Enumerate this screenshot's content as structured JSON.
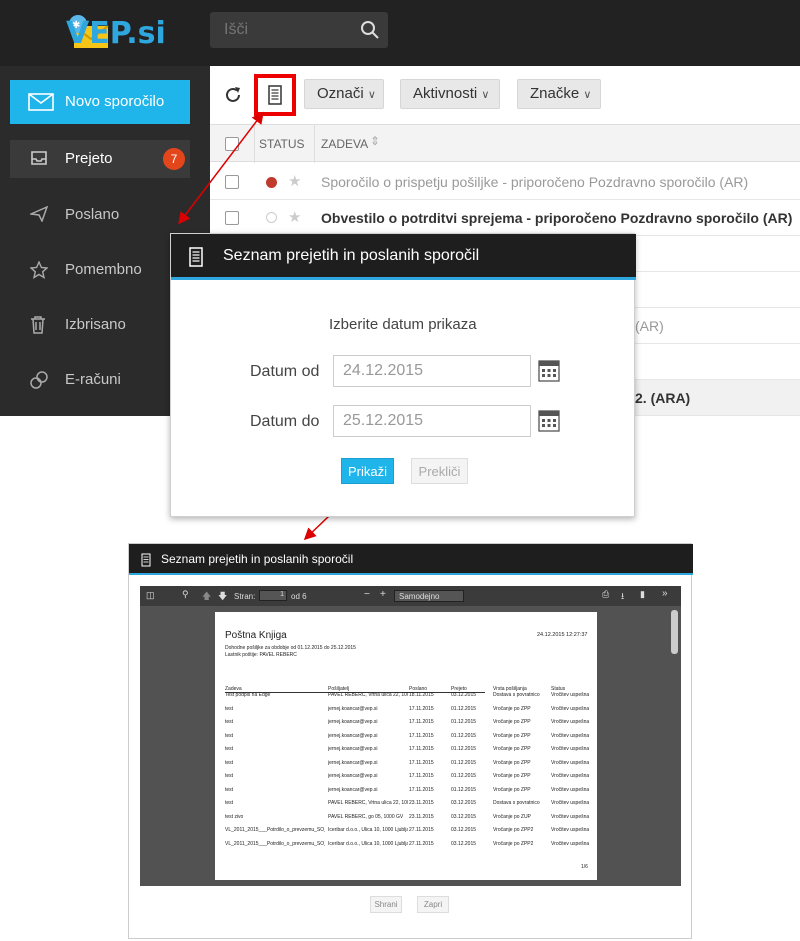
{
  "app": {
    "logo_text": "VEP.si",
    "search_placeholder": "Išči"
  },
  "sidebar": {
    "new_message": "Novo sporočilo",
    "items": [
      {
        "label": "Prejeto",
        "badge": "7"
      },
      {
        "label": "Poslano"
      },
      {
        "label": "Pomembno"
      },
      {
        "label": "Izbrisano"
      },
      {
        "label": "E-računi"
      }
    ]
  },
  "toolbar": {
    "oznaci": "Označi",
    "aktivnosti": "Aktivnosti",
    "znacke": "Značke"
  },
  "table": {
    "headers": {
      "status": "STATUS",
      "subject": "ZADEVA"
    },
    "rows": [
      {
        "subject": "Sporočilo o prispetju pošiljke - priporočeno Pozdravno sporočilo (AR)",
        "bold": false
      },
      {
        "subject": "Obvestilo o potrditvi sprejema - priporočeno Pozdravno sporočilo (AR)",
        "bold": true
      },
      {
        "subject": "(AR)",
        "bold": false
      },
      {
        "subject": "2. (ARA)",
        "bold": true
      }
    ]
  },
  "dialog": {
    "title": "Seznam prejetih in poslanih sporočil",
    "subtitle": "Izberite datum prikaza",
    "from_label": "Datum od",
    "from_value": "24.12.2015",
    "to_label": "Datum do",
    "to_value": "25.12.2015",
    "show_button": "Prikaži",
    "cancel_button": "Prekliči"
  },
  "report": {
    "title": "Seznam prejetih in poslanih sporočil",
    "pdf_toolbar": {
      "page_label": "Stran:",
      "page_value": "1",
      "of_label": "od 6",
      "zoom": "Samodejno"
    },
    "doc_title": "Poštna Knjiga",
    "doc_date": "24.12.2015 12:27:37",
    "doc_line1": "Dohodne pošiljke za obdobje od 01.12.2015 do 25.12.2015",
    "doc_line2": "Lastnik poštije: PAVEL REBERC",
    "columns": [
      "Zadeva",
      "Pošiljatelj",
      "Poslano",
      "Prejeto",
      "Vrsta pošiljanja",
      "Status"
    ],
    "rows": [
      [
        "Test podpis na Edge",
        "PAVEL REBERC, Vrtna ulica 22, 1000 Ljubljana",
        "18.11.2015",
        "03.12.2015",
        "Dostava s povratnico",
        "Vročitev uspešna"
      ],
      [
        "test",
        "jernej.koancar@vep.si",
        "17.11.2015",
        "01.12.2015",
        "Vročanje po ZPP",
        "Vročitev uspešna"
      ],
      [
        "test",
        "jernej.koancar@vep.si",
        "17.11.2015",
        "01.12.2015",
        "Vročanje po ZPP",
        "Vročitev uspešna"
      ],
      [
        "test",
        "jernej.koancar@vep.si",
        "17.11.2015",
        "01.12.2015",
        "Vročanje po ZPP",
        "Vročitev uspešna"
      ],
      [
        "test",
        "jernej.koancar@vep.si",
        "17.11.2015",
        "01.12.2015",
        "Vročanje po ZPP",
        "Vročitev uspešna"
      ],
      [
        "test",
        "jernej.koancar@vep.si",
        "17.11.2015",
        "01.12.2015",
        "Vročanje po ZPP",
        "Vročitev uspešna"
      ],
      [
        "test",
        "jernej.koancar@vep.si",
        "17.11.2015",
        "01.12.2015",
        "Vročanje po ZPP",
        "Vročitev uspešna"
      ],
      [
        "test",
        "jernej.koancar@vep.si",
        "17.11.2015",
        "01.12.2015",
        "Vročanje po ZPP",
        "Vročitev uspešna"
      ],
      [
        "test",
        "PAVEL REBERC, Vrtna ulica 22, 1000 Ljubljana",
        "23.11.2015",
        "03.12.2015",
        "Dostava s povratnico",
        "Vročitev uspešna"
      ],
      [
        "test zivo",
        "PAVEL REBERC, go 05, 1000 GV",
        "23.11.2015",
        "03.12.2015",
        "Vročanje po ZUP",
        "Vročitev uspešna"
      ],
      [
        "VL_2011_2015___Potrdilo_o_prevzemu_SO_izvoz",
        "Iceribar d.o.o., Ulica 10, 1000 Ljubljana",
        "27.11.2015",
        "03.12.2015",
        "Vročanje po ZPP2",
        "Vročitev uspešna"
      ],
      [
        "VL_2011_2015___Potrdilo_o_prevzemu_SO_izvoz",
        "Iceribar d.o.o., Ulica 10, 1000 Ljubljana",
        "27.11.2015",
        "03.12.2015",
        "Vročanje po ZPP2",
        "Vročitev uspešna"
      ]
    ],
    "page_footer": "1/6",
    "save_button": "Shrani",
    "close_button": "Zapri"
  }
}
